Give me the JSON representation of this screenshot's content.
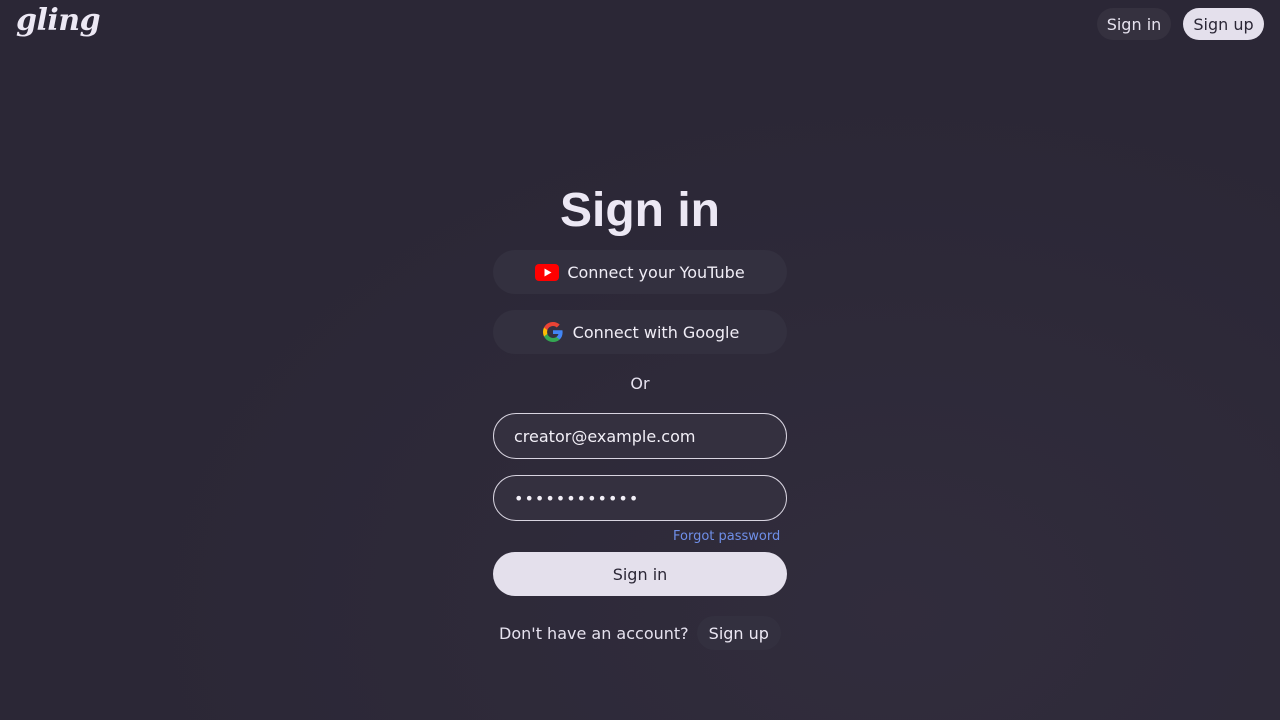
{
  "header": {
    "logo_text": "gling",
    "signin_label": "Sign in",
    "signup_label": "Sign up"
  },
  "form": {
    "title": "Sign in",
    "youtube_label": "Connect your YouTube",
    "youtube_icon": "youtube-icon",
    "google_label": "Connect with Google",
    "google_icon": "google-icon",
    "divider_text": "Or",
    "email_value": "creator@example.com",
    "password_value": "••••••••••••",
    "forgot_label": "Forgot password",
    "submit_label": "Sign in"
  },
  "footer": {
    "prompt_text": "Don't have an account?",
    "signup_label": "Sign up"
  },
  "colors": {
    "background": "#2b2736",
    "primary_button": "#e4e0ec",
    "link": "#6f8fe8",
    "youtube_red": "#ff0000"
  }
}
